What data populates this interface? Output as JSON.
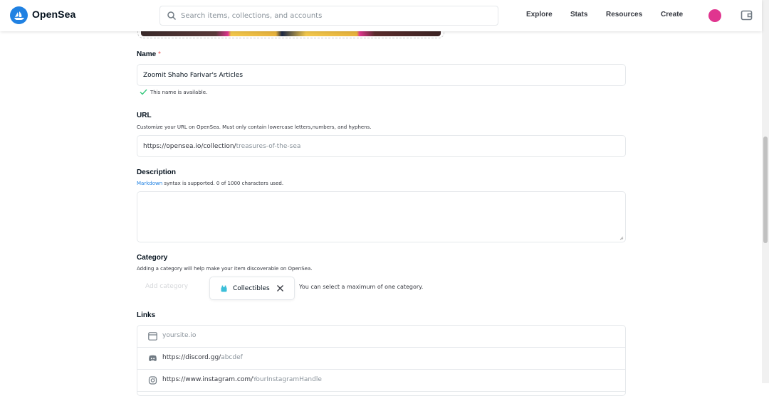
{
  "header": {
    "brand": "OpenSea",
    "search_placeholder": "Search items, collections, and accounts",
    "nav": [
      "Explore",
      "Stats",
      "Resources",
      "Create"
    ]
  },
  "form": {
    "name": {
      "label": "Name",
      "required_mark": "*",
      "value": "Zoomit Shaho Farivar's Articles",
      "status": "This name is available."
    },
    "url": {
      "label": "URL",
      "hint": "Customize your URL on OpenSea. Must only contain lowercase letters,numbers, and hyphens.",
      "prefix": "https://opensea.io/collection/",
      "placeholder": "treasures-of-the-sea"
    },
    "description": {
      "label": "Description",
      "hint_link": "Markdown",
      "hint_rest": " syntax is supported. 0 of 1000 characters used."
    },
    "category": {
      "label": "Category",
      "hint": "Adding a category will help make your item discoverable on OpenSea.",
      "add_label": "Add category",
      "selected": "Collectibles",
      "note": "You can select a maximum of one category."
    },
    "links": {
      "label": "Links",
      "rows": [
        {
          "icon": "web-icon",
          "prefix": "",
          "placeholder": "yoursite.io"
        },
        {
          "icon": "discord-icon",
          "prefix": "https://discord.gg/",
          "placeholder": "abcdef"
        },
        {
          "icon": "instagram-icon",
          "prefix": "https://www.instagram.com/",
          "placeholder": "YourInstagramHandle"
        }
      ]
    }
  },
  "colors": {
    "accent": "#2081e2",
    "avatar": "#e0358f",
    "success": "#34c77b",
    "required": "#eb5757"
  }
}
